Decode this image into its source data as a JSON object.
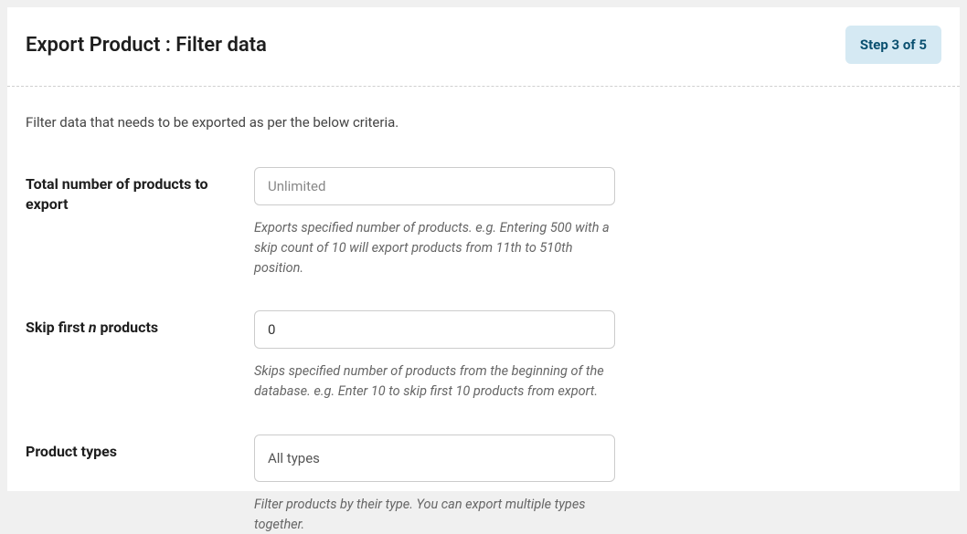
{
  "header": {
    "title": "Export Product : Filter data",
    "step_badge": "Step 3 of 5"
  },
  "intro": "Filter data that needs to be exported as per the below criteria.",
  "fields": {
    "total_products": {
      "label": "Total number of products to export",
      "placeholder": "Unlimited",
      "value": "",
      "help": "Exports specified number of products. e.g. Entering 500 with a skip count of 10 will export products from 11th to 510th position."
    },
    "skip_first": {
      "label_prefix": "Skip first ",
      "label_em": "n",
      "label_suffix": " products",
      "value": "0",
      "help": "Skips specified number of products from the beginning of the database. e.g. Enter 10 to skip first 10 products from export."
    },
    "product_types": {
      "label": "Product types",
      "selected": "All types",
      "help": "Filter products by their type. You can export multiple types together."
    }
  }
}
